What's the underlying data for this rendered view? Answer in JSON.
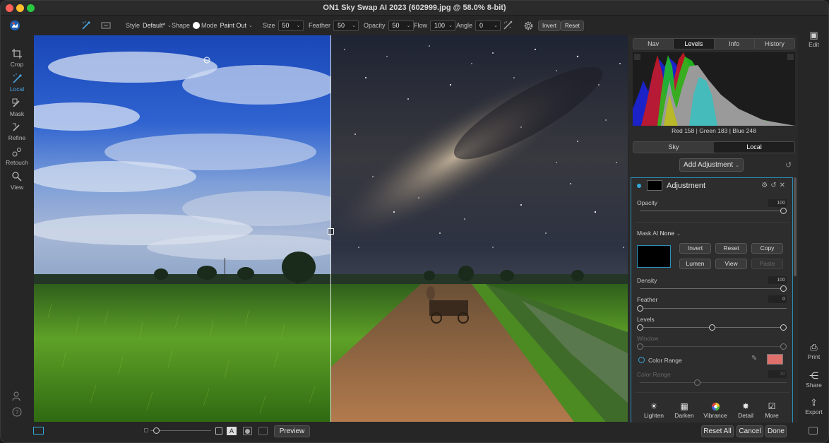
{
  "window": {
    "title": "ON1 Sky Swap AI 2023 (602999.jpg @ 58.0% 8-bit)"
  },
  "toolbar": {
    "style_label": "Style",
    "style_value": "Default*",
    "shape_label": "Shape",
    "mode_label": "Mode",
    "mode_value": "Paint Out",
    "size_label": "Size",
    "size_value": "50",
    "feather_label": "Feather",
    "feather_value": "50",
    "opacity_label": "Opacity",
    "opacity_value": "50",
    "flow_label": "Flow",
    "flow_value": "100",
    "angle_label": "Angle",
    "angle_value": "0",
    "invert_label": "Invert",
    "reset_label": "Reset"
  },
  "left_tools": [
    {
      "label": "Crop",
      "icon": "crop-icon"
    },
    {
      "label": "Local",
      "icon": "brush-icon",
      "active": true
    },
    {
      "label": "Mask",
      "icon": "mask-brush-icon"
    },
    {
      "label": "Refine",
      "icon": "refine-brush-icon"
    },
    {
      "label": "Retouch",
      "icon": "retouch-icon"
    },
    {
      "label": "View",
      "icon": "zoom-hand-icon"
    }
  ],
  "panel": {
    "tabs": [
      "Nav",
      "Levels",
      "Info",
      "History"
    ],
    "selected_tab": "Levels",
    "histogram_readout": "Red 158 | Green 183 | Blue 248",
    "mode_tabs": [
      "Sky",
      "Local"
    ],
    "selected_mode": "Local",
    "add_adjustment": "Add Adjustment",
    "adjustment": {
      "title": "Adjustment",
      "opacity_label": "Opacity",
      "opacity_value": "100",
      "mask_ai_label": "Mask AI",
      "mask_ai_value": "None",
      "mask_buttons": [
        "Invert",
        "Reset",
        "Copy",
        "Lumen",
        "View",
        "Paste"
      ],
      "density_label": "Density",
      "density_value": "100",
      "feather_label": "Feather",
      "feather_value": "0",
      "levels_label": "Levels",
      "window_label": "Window",
      "color_range_label": "Color Range",
      "color_range_sub_label": "Color Range",
      "color_range_value": "30",
      "color_range_swatch": "#e0706b"
    },
    "bottom_tools": [
      "Lighten",
      "Darken",
      "Vibrance",
      "Detail",
      "More"
    ]
  },
  "rail": {
    "edit": "Edit",
    "print": "Print",
    "share": "Share",
    "export": "Export"
  },
  "bottom": {
    "preview": "Preview",
    "reset_all": "Reset All",
    "cancel": "Cancel",
    "done": "Done"
  },
  "colors": {
    "accent": "#35a8d8",
    "active_tool": "#4aa3df"
  }
}
